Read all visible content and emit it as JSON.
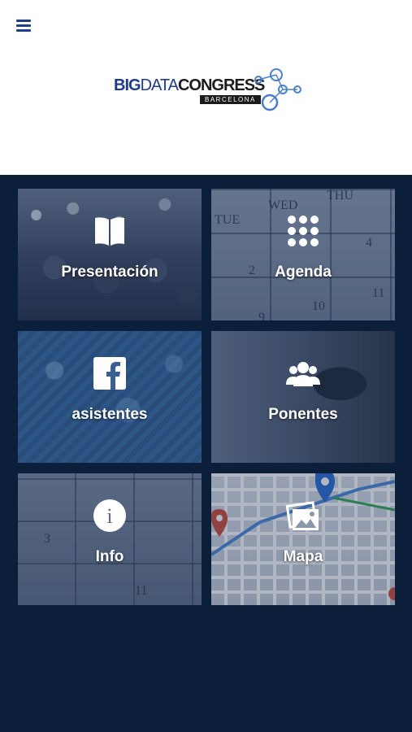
{
  "header": {
    "menu_icon": "hamburger-menu-icon",
    "logo": {
      "big": "BIG",
      "data": "DATA",
      "congress": "CONGRESS",
      "subtitle": "BARCELONA"
    }
  },
  "tiles": [
    {
      "label": "Presentación",
      "icon": "book-icon"
    },
    {
      "label": "Agenda",
      "icon": "grid-dots-icon"
    },
    {
      "label": "asistentes",
      "icon": "facebook-icon"
    },
    {
      "label": "Ponentes",
      "icon": "people-icon"
    },
    {
      "label": "Info",
      "icon": "info-icon"
    },
    {
      "label": "Mapa",
      "icon": "image-icon"
    }
  ],
  "calendar_labels": {
    "tue": "TUE",
    "wed": "WED",
    "thu": "THU",
    "d2": "2",
    "d3": "3",
    "d4": "4",
    "d9": "9",
    "d10": "10",
    "d11": "11"
  },
  "colors": {
    "brand_blue": "#1d3c8a",
    "background_navy": "#0b1e3a",
    "header_white": "#ffffff"
  }
}
